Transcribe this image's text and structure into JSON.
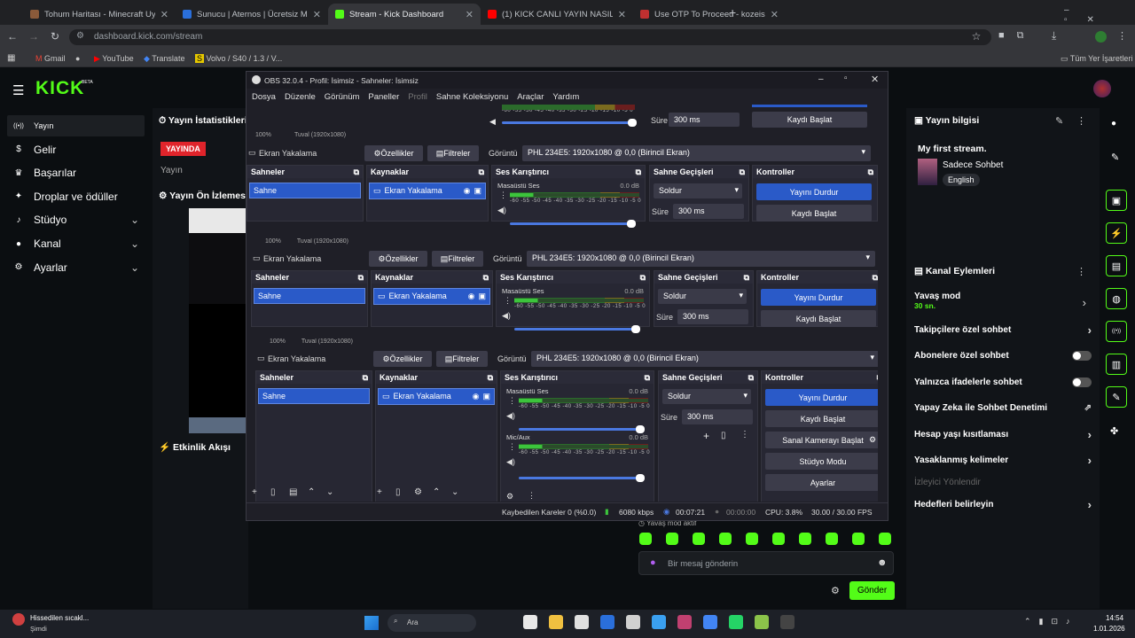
{
  "browser": {
    "tabs": [
      {
        "title": "Tohum Haritası - Minecraft Uygu",
        "color": "#8a5a3a"
      },
      {
        "title": "Sunucu | Aternos | Ücretsiz Min",
        "color": "#2a6fdb"
      },
      {
        "title": "Stream - Kick Dashboard",
        "color": "#53fc18"
      },
      {
        "title": "(1) KICK CANLI YAYIN NASIL YA",
        "color": "#ff0000"
      },
      {
        "title": "Use OTP To Proceed - kozeishal",
        "color": "#c03030"
      }
    ],
    "url": "dashboard.kick.com/stream",
    "bookmarks": [
      "Gmail",
      "YouTube",
      "Translate",
      "Volvo / S40 / 1.3 / V..."
    ],
    "all_bookmarks": "Tüm Yer İşaretleri"
  },
  "kick": {
    "logo": "KICK",
    "beta": "BETA",
    "nav": [
      {
        "label": "Yayın",
        "icon": "broadcast-icon",
        "arrow": false
      },
      {
        "label": "Gelir",
        "icon": "dollar-icon",
        "arrow": false
      },
      {
        "label": "Başarılar",
        "icon": "trophy-icon",
        "arrow": false
      },
      {
        "label": "Droplar ve ödüller",
        "icon": "gift-icon",
        "arrow": false
      },
      {
        "label": "Stüdyo",
        "icon": "mic-icon",
        "arrow": true
      },
      {
        "label": "Kanal",
        "icon": "user-icon",
        "arrow": true
      },
      {
        "label": "Ayarlar",
        "icon": "gear-icon",
        "arrow": true
      }
    ],
    "stats_title": "Yayın İstatistikleri",
    "live_badge": "YAYINDA",
    "stream_label": "Yayın",
    "preview_title": "Yayın Ön İzlemesi",
    "activity_title": "Etkinlik Akışı",
    "info_title": "Yayın bilgisi",
    "stream_title": "My first stream.",
    "category": "Sadece Sohbet",
    "language": "English",
    "channel_actions": "Kanal Eylemleri",
    "slow_mode": "Yavaş mod",
    "slow_mode_value": "30 sn.",
    "rows": [
      {
        "label": "Takipçilere özel sohbet",
        "type": "arrow"
      },
      {
        "label": "Abonelere özel sohbet",
        "type": "toggle"
      },
      {
        "label": "Yalnızca ifadelerle sohbet",
        "type": "toggle"
      },
      {
        "label": "Yapay Zeka ile Sohbet Denetimi",
        "type": "ext"
      },
      {
        "label": "Hesap yaşı kısıtlaması",
        "type": "arrow"
      },
      {
        "label": "Yasaklanmış kelimeler",
        "type": "arrow"
      },
      {
        "label": "İzleyici Yönlendir",
        "type": "disabled"
      },
      {
        "label": "Hedefleri belirleyin",
        "type": "arrow"
      }
    ],
    "slow_mode_active": "Yavaş mod aktif",
    "chat_placeholder": "Bir mesaj gönderin",
    "send": "Gönder"
  },
  "obs": {
    "title": "OBS 32.0.4 - Profil: İsimsiz - Sahneler: İsimsiz",
    "menu": [
      "Dosya",
      "Düzenle",
      "Görünüm",
      "Paneller",
      "Profil",
      "Sahne Koleksiyonu",
      "Araçlar",
      "Yardım"
    ],
    "source_name": "Ekran Yakalama",
    "properties": "Özellikler",
    "filters": "Filtreler",
    "display_label": "Görüntü",
    "display_value": "PHL 234E5: 1920x1080 @ 0,0 (Birincil Ekran)",
    "scenes": "Sahneler",
    "sources": "Kaynaklar",
    "mixer": "Ses Karıştırıcı",
    "transitions": "Sahne Geçişleri",
    "controls": "Kontroller",
    "scene_item": "Sahne",
    "desktop_audio": "Masaüstü Ses",
    "mic": "Mic/Aux",
    "db": "0.0 dB",
    "scale": "-60 -55 -50 -45 -40 -35 -30 -25 -20 -15 -10 -5 0",
    "transition": "Soldur",
    "duration_label": "Süre",
    "duration": "300 ms",
    "zoom": "100%",
    "canvas": "Tuval (1920x1080)",
    "stop_stream": "Yayını Durdur",
    "start_record": "Kaydı Başlat",
    "virtual_cam": "Sanal Kamerayı Başlat",
    "studio_mode": "Stüdyo Modu",
    "settings": "Ayarlar",
    "status": {
      "dropped": "Kaybedilen Kareler 0 (%0.0)",
      "bitrate": "6080 kbps",
      "live_time": "00:07:21",
      "rec_time": "00:00:00",
      "cpu": "CPU: 3.8%",
      "fps": "30.00 / 30.00 FPS"
    }
  },
  "taskbar": {
    "weather": "Hissedilen sıcakl...",
    "weather_sub": "Şimdi",
    "search": "Ara",
    "time": "14:54",
    "date": "1.01.2026"
  }
}
